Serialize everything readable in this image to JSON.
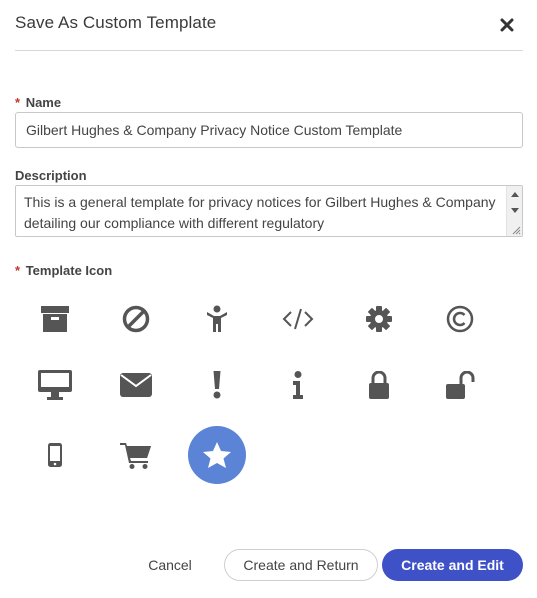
{
  "dialog": {
    "title": "Save As Custom Template",
    "close_icon": "close-icon"
  },
  "form": {
    "required_marker": "*",
    "name_label": "Name",
    "name_value": "Gilbert Hughes & Company Privacy Notice Custom Template",
    "description_label": "Description",
    "description_value": "This is a general template for privacy notices for Gilbert Hughes & Company detailing our compliance with different regulatory",
    "template_icon_label": "Template Icon"
  },
  "icons": [
    {
      "name": "archive-box-icon",
      "selected": false
    },
    {
      "name": "ban-icon",
      "selected": false
    },
    {
      "name": "child-figure-icon",
      "selected": false
    },
    {
      "name": "code-icon",
      "selected": false
    },
    {
      "name": "gear-icon",
      "selected": false
    },
    {
      "name": "copyright-icon",
      "selected": false
    },
    {
      "name": "desktop-monitor-icon",
      "selected": false
    },
    {
      "name": "envelope-icon",
      "selected": false
    },
    {
      "name": "exclamation-icon",
      "selected": false
    },
    {
      "name": "info-icon",
      "selected": false
    },
    {
      "name": "lock-icon",
      "selected": false
    },
    {
      "name": "unlock-icon",
      "selected": false
    },
    {
      "name": "mobile-phone-icon",
      "selected": false
    },
    {
      "name": "shopping-cart-icon",
      "selected": false
    },
    {
      "name": "star-icon",
      "selected": true
    }
  ],
  "colors": {
    "icon": "#555555",
    "selected_bg": "#5b84d6",
    "primary_button": "#3f51c7",
    "required": "#c0392b"
  },
  "footer": {
    "cancel_label": "Cancel",
    "create_return_label": "Create and Return",
    "create_edit_label": "Create and Edit"
  }
}
